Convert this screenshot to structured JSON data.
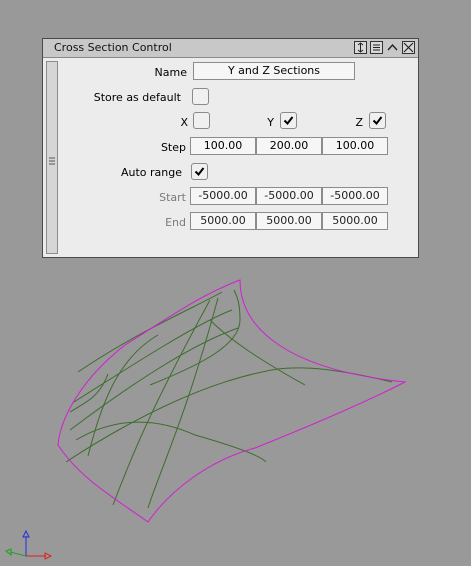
{
  "window": {
    "title": "Cross Section Control"
  },
  "titlebar_buttons": [
    "resize-icon",
    "menu-icon",
    "collapse-icon",
    "close-icon"
  ],
  "form": {
    "name_label": "Name",
    "name_value": "Y and Z Sections",
    "store_default_label": "Store as default",
    "store_default_checked": false,
    "x_label": "X",
    "x_checked": false,
    "y_label": "Y",
    "y_checked": true,
    "z_label": "Z",
    "z_checked": true,
    "step_label": "Step",
    "step_values": [
      "100.00",
      "200.00",
      "100.00"
    ],
    "auto_range_label": "Auto range",
    "auto_range_checked": true,
    "start_label": "Start",
    "start_values": [
      "-5000.00",
      "-5000.00",
      "-5000.00"
    ],
    "end_label": "End",
    "end_values": [
      "5000.00",
      "5000.00",
      "5000.00"
    ]
  },
  "viewport": {
    "background": "#999999",
    "surface_edge_color": "#d020d0",
    "section_line_color": "#3c6e2c"
  },
  "axes": [
    "x-axis-red",
    "y-axis-green",
    "z-axis-blue"
  ]
}
